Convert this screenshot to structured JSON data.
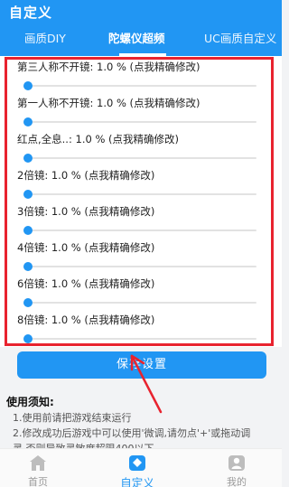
{
  "app": {
    "title": "自定义"
  },
  "tabs": [
    {
      "label": "画质DIY"
    },
    {
      "label": "陀螺仪超频"
    },
    {
      "label": "UC画质自定义"
    }
  ],
  "settings": [
    {
      "label": "第三人称不开镜: 1.0 % (点我精确修改)",
      "value": 0.0
    },
    {
      "label": "第一人称不开镜: 1.0 % (点我精确修改)",
      "value": 0.0
    },
    {
      "label": "红点,全息..: 1.0 % (点我精确修改)",
      "value": 0.0
    },
    {
      "label": "2倍镜: 1.0 % (点我精确修改)",
      "value": 0.0
    },
    {
      "label": "3倍镜: 1.0 % (点我精确修改)",
      "value": 0.0
    },
    {
      "label": "4倍镜: 1.0 % (点我精确修改)",
      "value": 0.0
    },
    {
      "label": "6倍镜: 1.0 % (点我精确修改)",
      "value": 0.0
    },
    {
      "label": "8倍镜: 1.0 % (点我精确修改)",
      "value": 0.0
    }
  ],
  "save_button": {
    "label": "保存设置"
  },
  "notes": {
    "title": "使用须知:",
    "lines": [
      "1.使用前请把游戏结束运行",
      "2.修改成功后游戏中可以使用'微调,请勿点'+'或拖动调",
      "灵,否则导致灵敏度超限400以下"
    ]
  },
  "bottom_nav": [
    {
      "label": "首页",
      "icon": "home-icon"
    },
    {
      "label": "自定义",
      "icon": "custom-icon"
    },
    {
      "label": "我的",
      "icon": "user-icon"
    }
  ],
  "colors": {
    "primary": "#2196f3",
    "highlight": "#e8232f"
  }
}
